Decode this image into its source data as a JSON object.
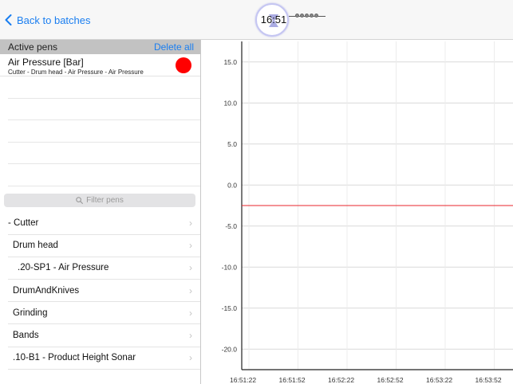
{
  "nav": {
    "back_label": "Back to batches",
    "clock_time": "16:51"
  },
  "active_pens": {
    "header_title": "Active pens",
    "delete_all_label": "Delete all",
    "pens": [
      {
        "name": "Air Pressure [Bar]",
        "path": "Cutter - Drum head - Air Pressure - Air Pressure",
        "color": "#ff0000"
      }
    ]
  },
  "filter": {
    "placeholder": "Filter pens",
    "icon": "search-icon"
  },
  "tree": {
    "items": [
      {
        "label": "- Cutter"
      },
      {
        "label": "Drum head"
      },
      {
        "label": ".20-SP1 - Air Pressure"
      },
      {
        "label": "DrumAndKnives"
      },
      {
        "label": "Grinding"
      },
      {
        "label": "Bands"
      },
      {
        "label": ".10-B1 - Product Height Sonar"
      }
    ]
  },
  "chart_data": {
    "type": "line",
    "title": "",
    "xlabel": "",
    "ylabel": "",
    "ylim": [
      -22.5,
      17.5
    ],
    "y_ticks": [
      "15.0",
      "10.0",
      "5.0",
      "0.0",
      "-5.0",
      "-10.0",
      "-15.0",
      "-20.0"
    ],
    "y_tick_values": [
      15,
      10,
      5,
      0,
      -5,
      -10,
      -15,
      -20
    ],
    "x_ticks": [
      "16:51:22",
      "16:51:52",
      "16:52:22",
      "16:52:52",
      "16:53:22",
      "16:53:52"
    ],
    "grid": true,
    "series": [
      {
        "color": "#e8262b",
        "x": [
          "16:51:22",
          "16:53:52"
        ],
        "values": [
          -2.5,
          -2.5
        ]
      }
    ]
  }
}
